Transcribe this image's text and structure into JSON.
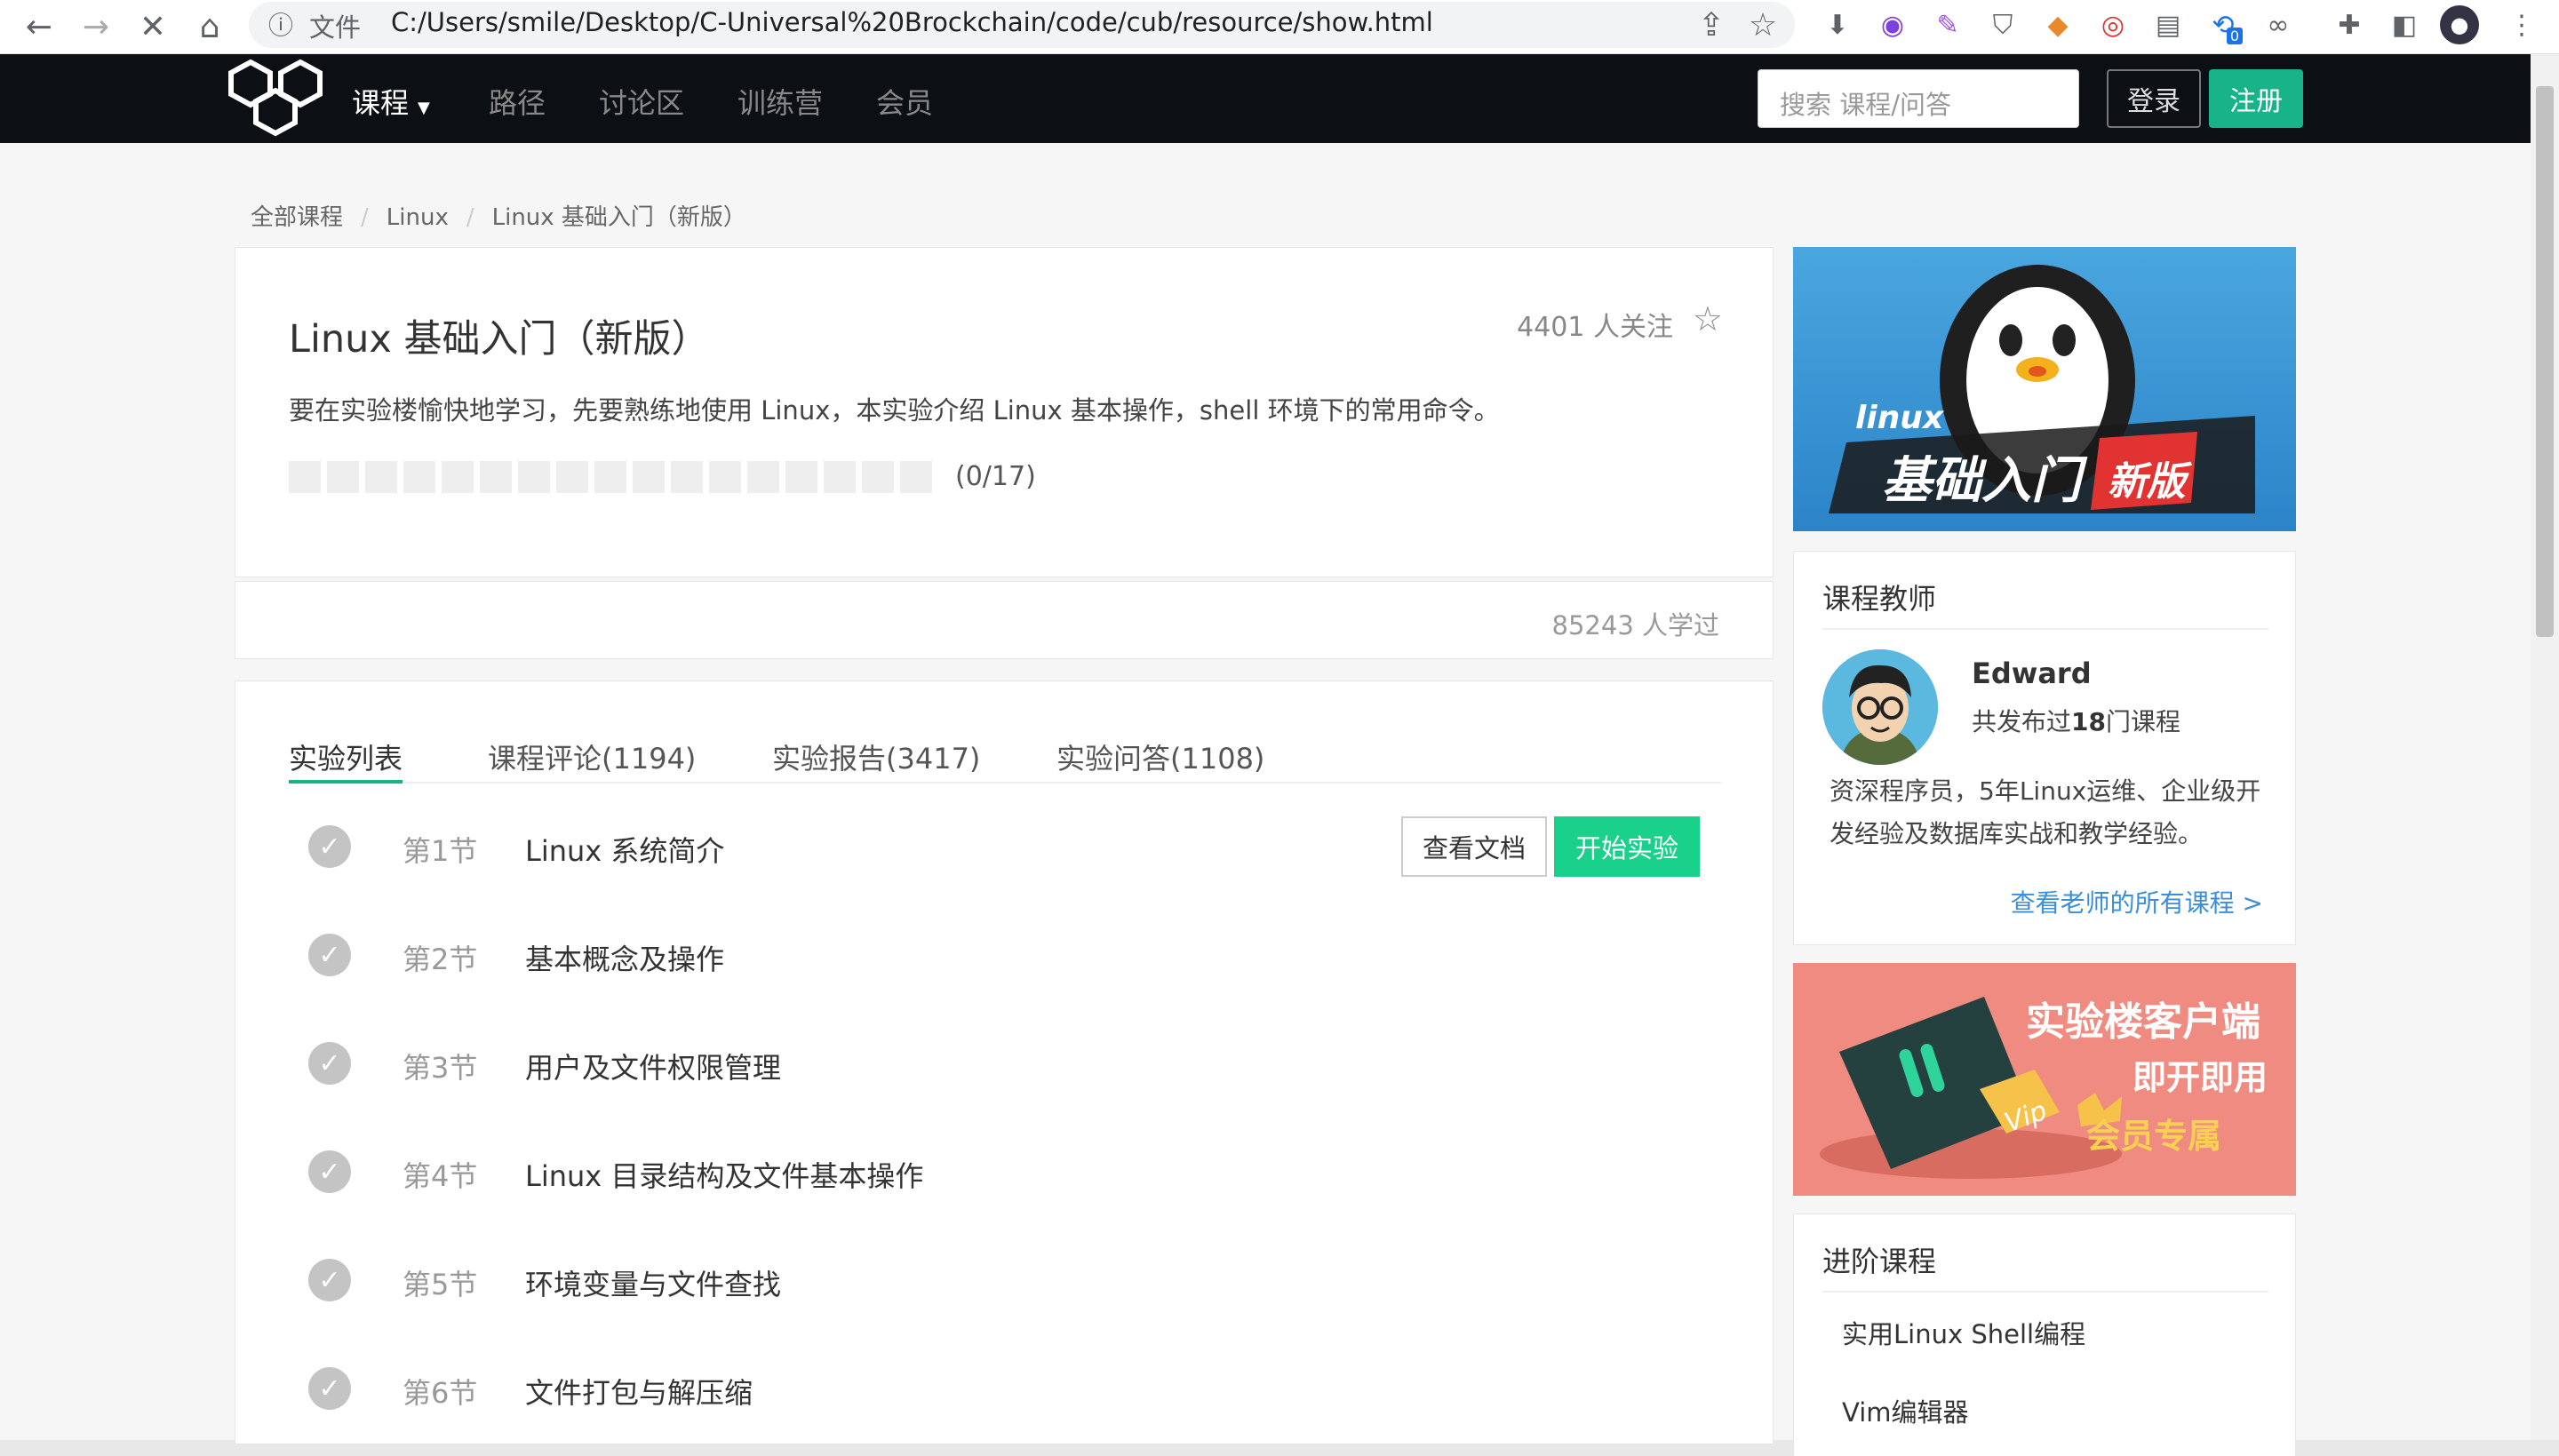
{
  "browser": {
    "scheme_label": "文件",
    "url": "C:/Users/smile/Desktop/C-Universal%20Brockchain/code/cub/resource/show.html",
    "ext_badge": "0"
  },
  "nav": {
    "items": [
      "课程",
      "路径",
      "讨论区",
      "训练营",
      "会员"
    ],
    "search_placeholder": "搜索 课程/问答",
    "login": "登录",
    "register": "注册"
  },
  "breadcrumb": [
    "全部课程",
    "Linux",
    "Linux 基础入门（新版）"
  ],
  "course": {
    "title": "Linux 基础入门（新版）",
    "followers": "4401 人关注",
    "description": "要在实验楼愉快地学习，先要熟练地使用 Linux，本实验介绍 Linux 基本操作，shell 环境下的常用命令。",
    "progress_text": "(0/17)",
    "progress_done": 0,
    "progress_total": 17,
    "studied": "85243 人学过"
  },
  "tabs": [
    "实验列表",
    "课程评论(1194)",
    "实验报告(3417)",
    "实验问答(1108)"
  ],
  "labs": [
    {
      "num": "第1节",
      "name": "Linux 系统简介"
    },
    {
      "num": "第2节",
      "name": "基本概念及操作"
    },
    {
      "num": "第3节",
      "name": "用户及文件权限管理"
    },
    {
      "num": "第4节",
      "name": "Linux 目录结构及文件基本操作"
    },
    {
      "num": "第5节",
      "name": "环境变量与文件查找"
    },
    {
      "num": "第6节",
      "name": "文件打包与解压缩"
    }
  ],
  "lab_actions": {
    "doc": "查看文档",
    "start": "开始实验"
  },
  "banner": {
    "line1": "linux",
    "line2": "基础入门",
    "tag": "新版"
  },
  "teacher": {
    "section_title": "课程教师",
    "name": "Edward",
    "count_prefix": "共发布过",
    "count": "18",
    "count_suffix": "门课程",
    "bio": "资深程序员，5年Linux运维、企业级开发经验及数据库实战和教学经验。",
    "link": "查看老师的所有课程 >"
  },
  "ad": {
    "line1": "实验楼客户端",
    "line2": "即开即用",
    "line3": "会员专属",
    "vip": "Vip"
  },
  "advanced": {
    "section_title": "进阶课程",
    "items": [
      "实用Linux Shell编程",
      "Vim编辑器"
    ]
  }
}
